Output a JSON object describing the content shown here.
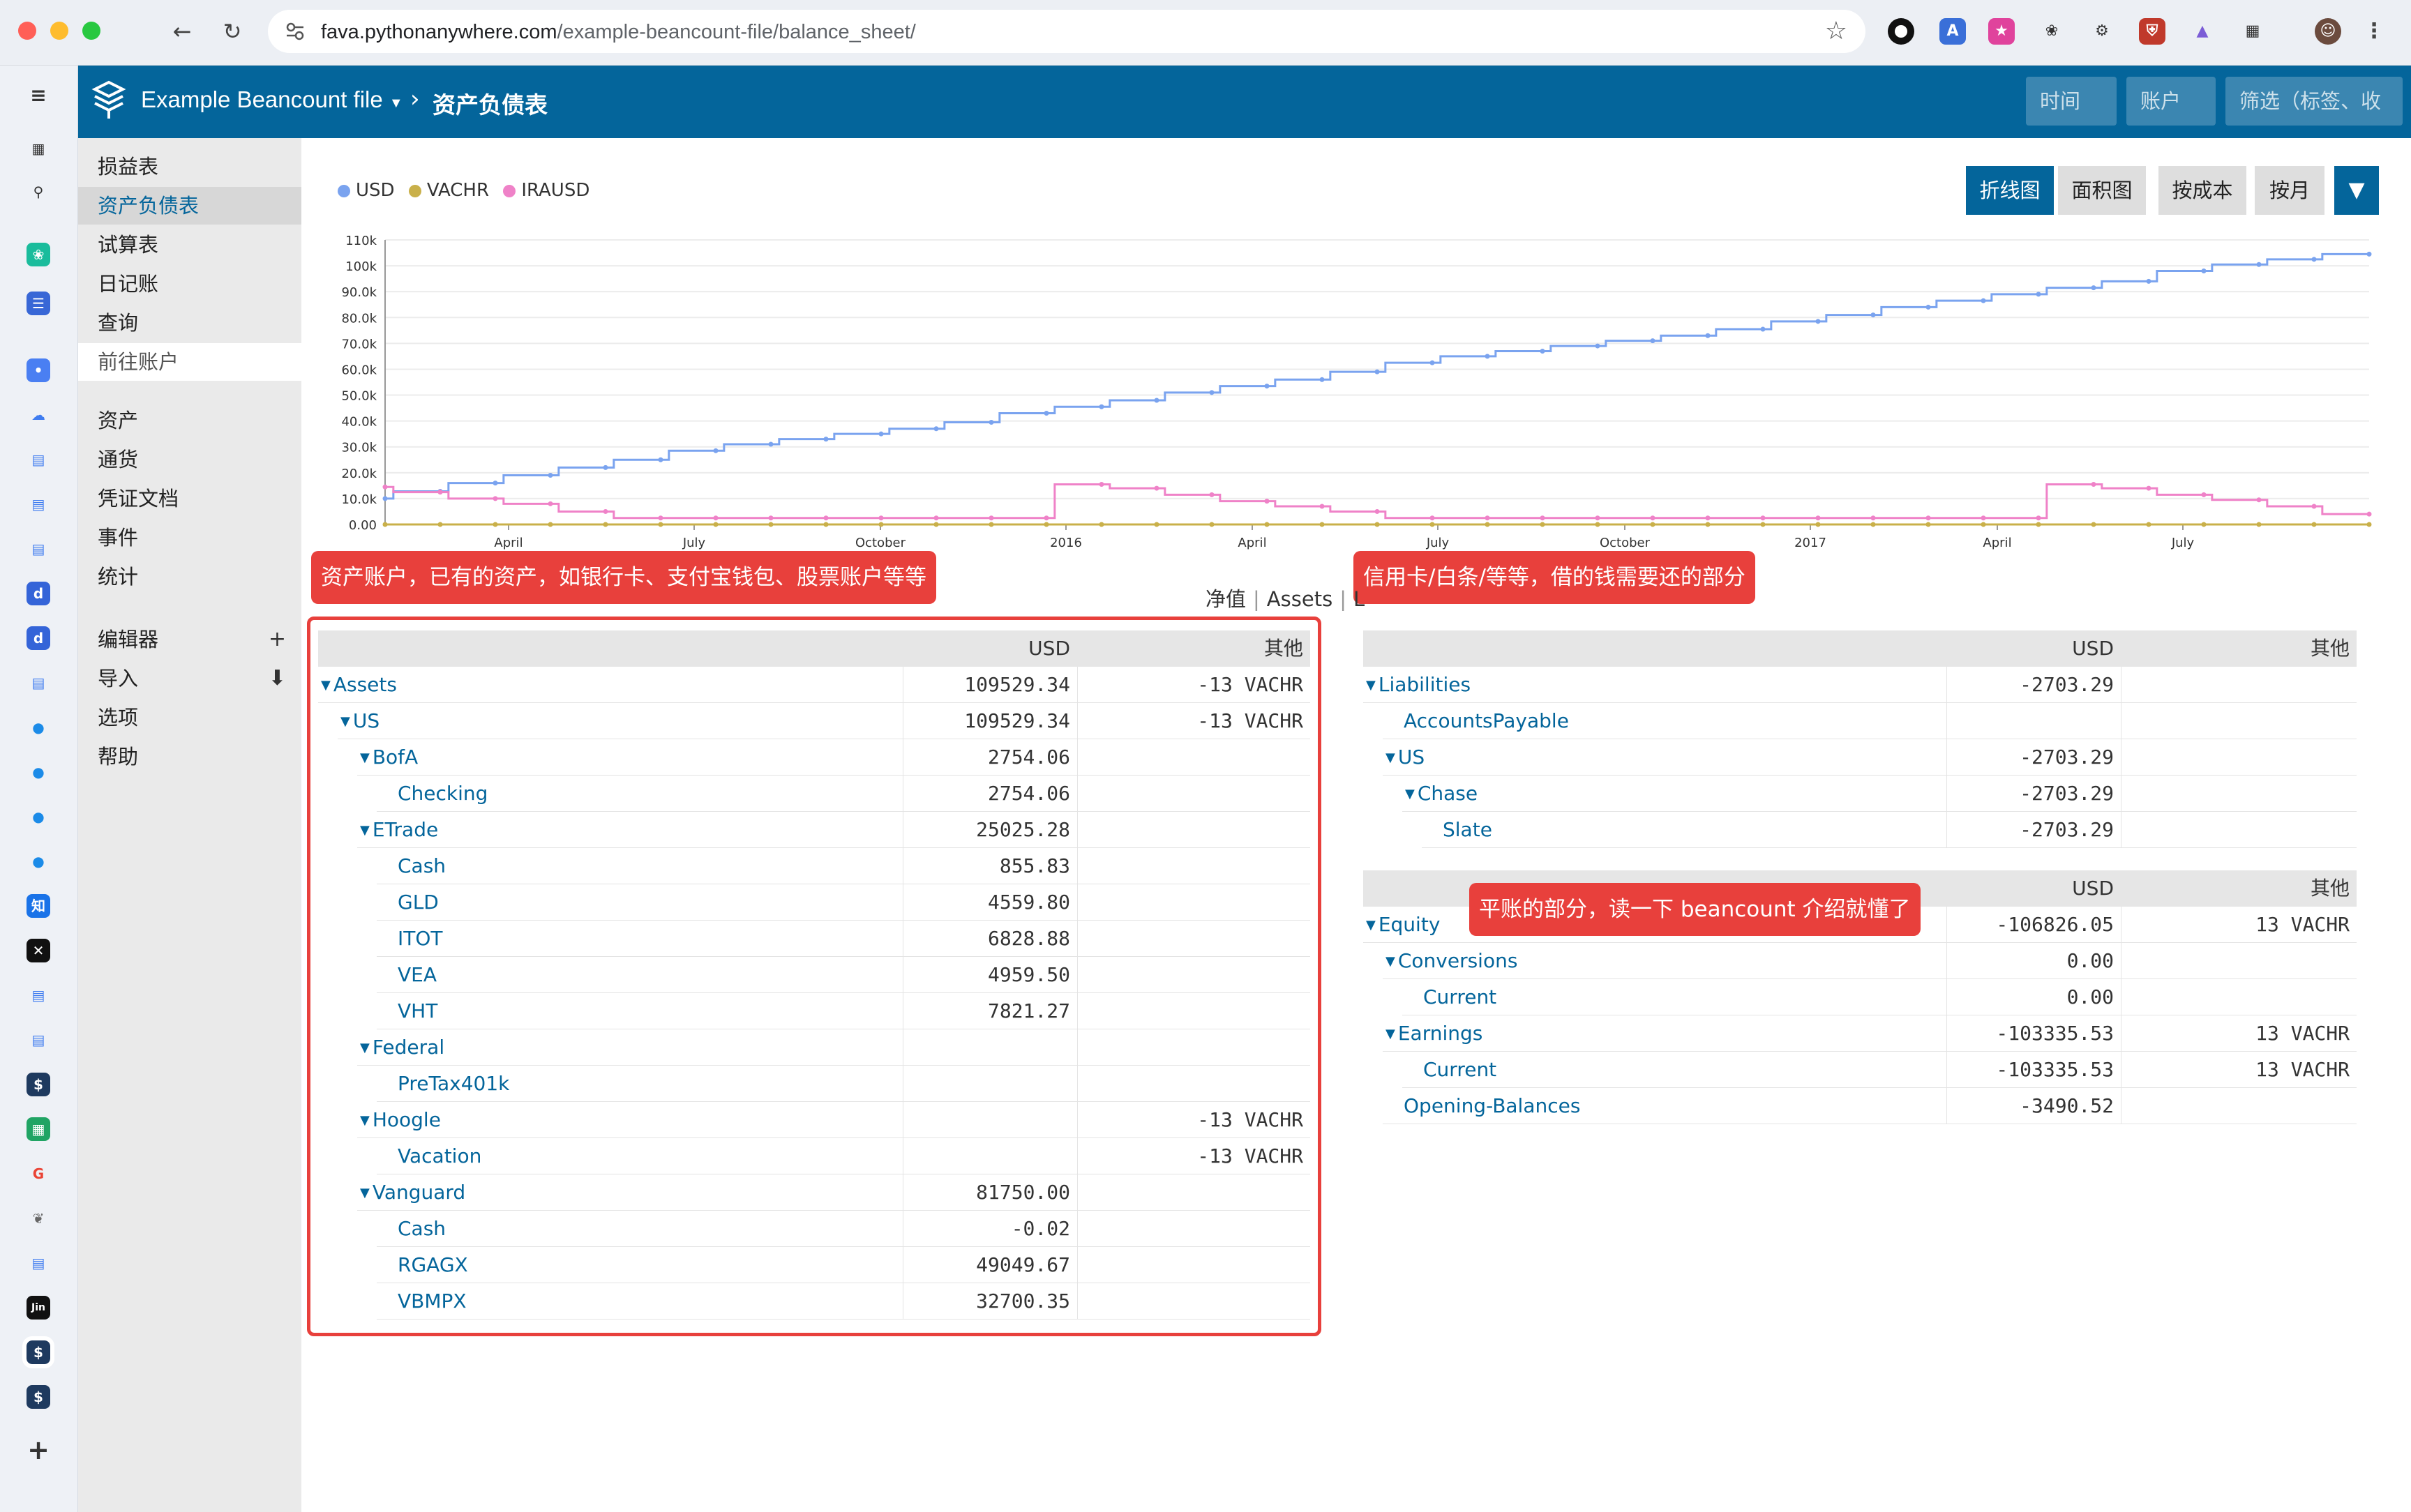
{
  "browser": {
    "url_host": "fava.pythonanywhere.com",
    "url_path": "/example-beancount-file/balance_sheet/"
  },
  "header": {
    "ledger_name": "Example Beancount file",
    "page_title": "资产负债表",
    "time_placeholder": "时间",
    "account_placeholder": "账户",
    "filter_placeholder": "筛选（标签、收"
  },
  "aside": {
    "group1": [
      "损益表",
      "资产负债表",
      "试算表",
      "日记账",
      "查询",
      "前往账户"
    ],
    "group2": [
      "资产",
      "通货",
      "凭证文档",
      "事件",
      "统计"
    ],
    "group3": [
      "编辑器",
      "导入",
      "选项",
      "帮助"
    ]
  },
  "chart_controls": {
    "line": "折线图",
    "area": "面积图",
    "at_cost": "按成本",
    "monthly": "按月"
  },
  "chart_data": {
    "type": "line",
    "legend": [
      "USD",
      "VACHR",
      "IRAUSD"
    ],
    "y_ticks": [
      "0.00",
      "10.0k",
      "20.0k",
      "30.0k",
      "40.0k",
      "50.0k",
      "60.0k",
      "70.0k",
      "80.0k",
      "90.0k",
      "100k",
      "110k"
    ],
    "ylim": [
      0,
      110000
    ],
    "x_ticks": [
      "April",
      "July",
      "October",
      "2016",
      "April",
      "July",
      "October",
      "2017",
      "April",
      "July"
    ],
    "series": [
      {
        "name": "USD",
        "color": "#7aa3ef",
        "values": [
          10000,
          12800,
          16000,
          19000,
          22000,
          25000,
          28500,
          31000,
          33000,
          35000,
          37000,
          39500,
          43000,
          45500,
          48000,
          51000,
          53500,
          56000,
          59000,
          62500,
          65000,
          67000,
          69000,
          71000,
          73000,
          75500,
          78500,
          81000,
          84000,
          86500,
          89000,
          91500,
          94000,
          98000,
          100500,
          102500,
          104500
        ]
      },
      {
        "name": "VACHR",
        "color": "#c9b04a",
        "values": [
          0,
          0,
          0,
          0,
          0,
          0,
          0,
          0,
          0,
          0,
          0,
          0,
          0,
          0,
          0,
          0,
          0,
          0,
          0,
          0,
          0,
          0,
          0,
          0,
          0,
          0,
          0,
          0,
          0,
          0,
          0,
          0,
          0,
          0,
          0,
          0,
          0
        ]
      },
      {
        "name": "IRAUSD",
        "color": "#ef82c8",
        "values": [
          14500,
          12500,
          10000,
          8000,
          5000,
          2500,
          2500,
          2500,
          2500,
          2500,
          2500,
          2500,
          2500,
          15500,
          14000,
          11500,
          9000,
          7000,
          5000,
          2500,
          2500,
          2500,
          2500,
          2500,
          2500,
          2500,
          2500,
          2500,
          2500,
          2500,
          2500,
          15500,
          14000,
          11500,
          9500,
          7000,
          4000
        ]
      }
    ]
  },
  "annotations": {
    "assets_note": "资产账户，已有的资产，如银行卡、支付宝钱包、股票账户等等",
    "liabilities_note": "信用卡/白条/等等，借的钱需要还的部分",
    "equity_note": "平账的部分，读一下 beancount 介绍就懂了"
  },
  "tabs": [
    "净值",
    "Assets",
    "L"
  ],
  "assets_table": {
    "col_usd": "USD",
    "col_other": "其他",
    "rows": [
      {
        "name": "Assets",
        "usd": "109529.34",
        "other": "-13 VACHR"
      },
      {
        "name": "US",
        "usd": "109529.34",
        "other": "-13 VACHR"
      },
      {
        "name": "BofA",
        "usd": "2754.06",
        "other": ""
      },
      {
        "name": "Checking",
        "usd": "2754.06",
        "other": ""
      },
      {
        "name": "ETrade",
        "usd": "25025.28",
        "other": ""
      },
      {
        "name": "Cash",
        "usd": "855.83",
        "other": ""
      },
      {
        "name": "GLD",
        "usd": "4559.80",
        "other": ""
      },
      {
        "name": "ITOT",
        "usd": "6828.88",
        "other": ""
      },
      {
        "name": "VEA",
        "usd": "4959.50",
        "other": ""
      },
      {
        "name": "VHT",
        "usd": "7821.27",
        "other": ""
      },
      {
        "name": "Federal",
        "usd": "",
        "other": ""
      },
      {
        "name": "PreTax401k",
        "usd": "",
        "other": ""
      },
      {
        "name": "Hoogle",
        "usd": "",
        "other": "-13 VACHR"
      },
      {
        "name": "Vacation",
        "usd": "",
        "other": "-13 VACHR"
      },
      {
        "name": "Vanguard",
        "usd": "81750.00",
        "other": ""
      },
      {
        "name": "Cash",
        "usd": "-0.02",
        "other": ""
      },
      {
        "name": "RGAGX",
        "usd": "49049.67",
        "other": ""
      },
      {
        "name": "VBMPX",
        "usd": "32700.35",
        "other": ""
      }
    ]
  },
  "liabilities_table": {
    "col_usd": "USD",
    "col_other": "其他",
    "rows": [
      {
        "name": "Liabilities",
        "usd": "-2703.29",
        "other": ""
      },
      {
        "name": "AccountsPayable",
        "usd": "",
        "other": ""
      },
      {
        "name": "US",
        "usd": "-2703.29",
        "other": ""
      },
      {
        "name": "Chase",
        "usd": "-2703.29",
        "other": ""
      },
      {
        "name": "Slate",
        "usd": "-2703.29",
        "other": ""
      }
    ]
  },
  "equity_table": {
    "col_usd": "USD",
    "col_other": "其他",
    "rows": [
      {
        "name": "Equity",
        "usd": "-106826.05",
        "other": "13 VACHR"
      },
      {
        "name": "Conversions",
        "usd": "0.00",
        "other": ""
      },
      {
        "name": "Current",
        "usd": "0.00",
        "other": ""
      },
      {
        "name": "Earnings",
        "usd": "-103335.53",
        "other": "13 VACHR"
      },
      {
        "name": "Current",
        "usd": "-103335.53",
        "other": "13 VACHR"
      },
      {
        "name": "Opening-Balances",
        "usd": "-3490.52",
        "other": ""
      }
    ]
  }
}
